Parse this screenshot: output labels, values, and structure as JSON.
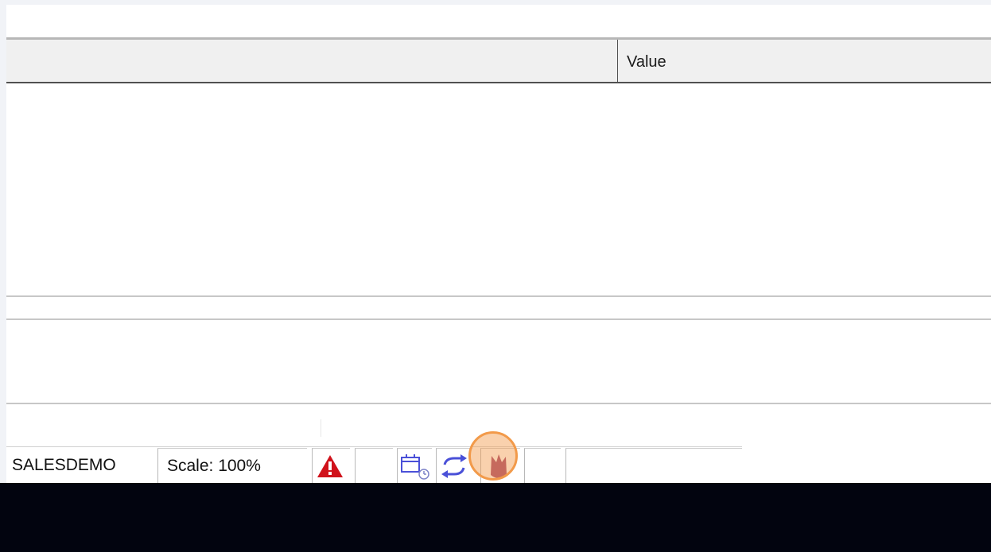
{
  "grid": {
    "columns": [
      "",
      "Value"
    ]
  },
  "status_bar": {
    "company": "SALESDEMO",
    "scale": "Scale: 100%",
    "icons": [
      "warning-icon",
      "calendar-clock-icon",
      "sync-icon",
      "timer-icon"
    ]
  },
  "colors": {
    "warning": "#d0121b",
    "accent_icon": "#4a50d8",
    "highlight": "#f29a4a"
  }
}
